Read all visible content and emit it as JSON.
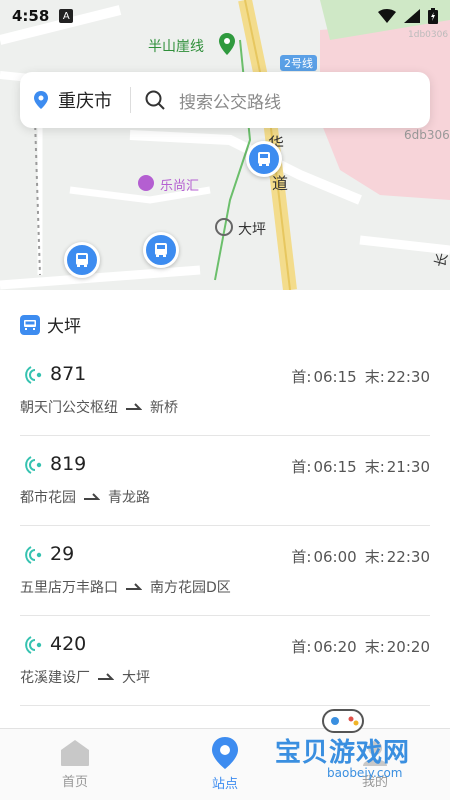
{
  "status_bar": {
    "time": "4:58",
    "app_icon": "A"
  },
  "map": {
    "labels": {
      "line_banshan": "半山崖线",
      "line2": "2号线",
      "poi_lesh": "乐尚汇",
      "station_daping": "大坪",
      "road_hua": "华",
      "road_dao": "道",
      "road_chang": "长",
      "right_code": "6db306",
      "tiny_code": "1db0306"
    }
  },
  "search": {
    "city": "重庆市",
    "placeholder": "搜索公交路线"
  },
  "station": {
    "name": "大坪"
  },
  "routes": [
    {
      "number": "871",
      "first_label": "首:",
      "first": "06:15",
      "last_label": "末:",
      "last": "22:30",
      "from": "朝天门公交枢纽",
      "to": "新桥"
    },
    {
      "number": "819",
      "first_label": "首:",
      "first": "06:15",
      "last_label": "末:",
      "last": "21:30",
      "from": "都市花园",
      "to": "青龙路"
    },
    {
      "number": "29",
      "first_label": "首:",
      "first": "06:00",
      "last_label": "末:",
      "last": "22:30",
      "from": "五里店万丰路口",
      "to": "南方花园D区"
    },
    {
      "number": "420",
      "first_label": "首:",
      "first": "06:20",
      "last_label": "末:",
      "last": "20:20",
      "from": "花溪建设厂",
      "to": "大坪"
    }
  ],
  "nav": {
    "home": "首页",
    "stops": "站点",
    "third": "我的"
  },
  "watermark": {
    "text": "宝贝游戏网",
    "url": "baobeiy.com"
  },
  "colors": {
    "accent": "#3d8cf0"
  }
}
